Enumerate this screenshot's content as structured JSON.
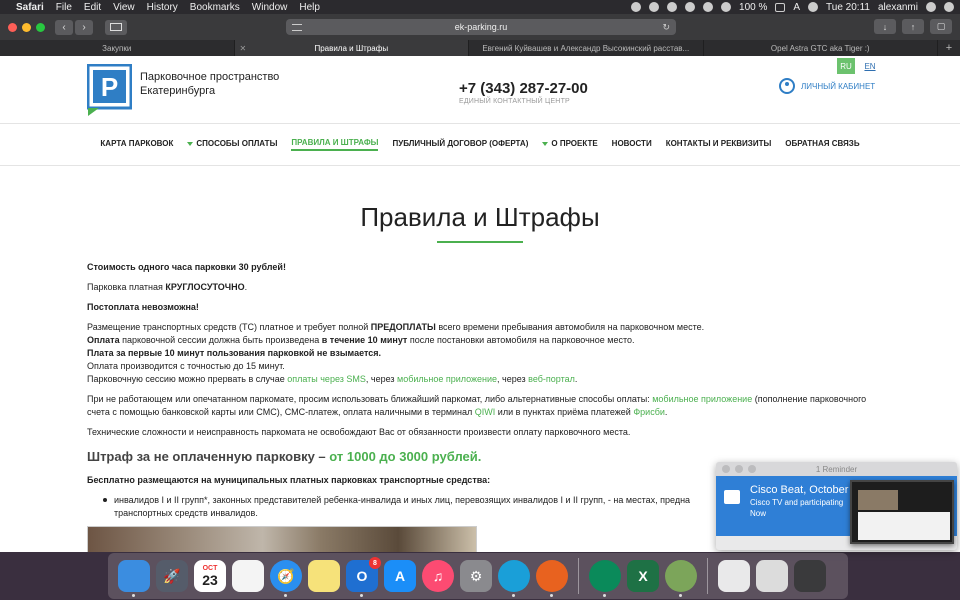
{
  "menubar": {
    "app": "Safari",
    "items": [
      "File",
      "Edit",
      "View",
      "History",
      "Bookmarks",
      "Window",
      "Help"
    ],
    "battery": "100 %",
    "input_lang": "A",
    "clock": "Tue 20:11",
    "user": "alexanmi"
  },
  "browser": {
    "url": "ek-parking.ru",
    "tabs": [
      {
        "label": "Закупки"
      },
      {
        "label": "Правила и Штрафы"
      },
      {
        "label": "Евгений Куйвашев и Александр Высокинский расстав..."
      },
      {
        "label": "Opel Astra GTC aka Tiger :)"
      }
    ]
  },
  "site": {
    "brand_line1": "Парковочное пространство",
    "brand_line2": "Екатеринбурга",
    "phone": "+7 (343) 287-27-00",
    "phone_sub": "ЕДИНЫЙ КОНТАКТНЫЙ ЦЕНТР",
    "lang_ru": "RU",
    "lang_en": "EN",
    "cabinet": "ЛИЧНЫЙ КАБИНЕТ",
    "nav": [
      {
        "label": "КАРТА ПАРКОВОК"
      },
      {
        "label": "СПОСОБЫ ОПЛАТЫ"
      },
      {
        "label": "ПРАВИЛА И ШТРАФЫ"
      },
      {
        "label": "ПУБЛИЧНЫЙ ДОГОВОР (ОФЕРТА)"
      },
      {
        "label": "О ПРОЕКТЕ"
      },
      {
        "label": "НОВОСТИ"
      },
      {
        "label": "КОНТАКТЫ И РЕКВИЗИТЫ"
      },
      {
        "label": "ОБРАТНАЯ СВЯЗЬ"
      }
    ]
  },
  "content": {
    "title": "Правила и Штрафы",
    "p1": "Стоимость одного часа парковки 30 рублей!",
    "p2a": "Парковка платная ",
    "p2b": "КРУГЛОСУТОЧНО",
    "p2c": ".",
    "p3": "Постоплата невозможна!",
    "p4a": "Размещение транспортных средств (ТС) платное и требует полной ",
    "p4b": "ПРЕДОПЛАТЫ",
    "p4c": " всего времени пребывания автомобиля на парковочном месте.",
    "p5a": "Оплата",
    "p5b": " парковочной сессии должна быть произведена ",
    "p5c": "в течение 10 минут",
    "p5d": " после постановки автомобиля на парковочное место.",
    "p6": "Плата за первые 10 минут пользования парковкой не взымается.",
    "p7": "Оплата производится с точностью до 15 минут.",
    "p8a": "Парковочную сессию можно прервать в случае ",
    "p8b": "оплаты через SMS",
    "p8c": ", через ",
    "p8d": "мобильное приложение",
    "p8e": ", через ",
    "p8f": "веб-портал",
    "p8g": ".",
    "p9a": "При не работающем или опечатанном паркомате, просим использовать ближайший паркомат, либо альтернативные способы оплаты: ",
    "p9b": "мобильное приложение",
    "p9c": " (пополнение парковочного счета с помощью банковской карты или СМС), СМС-платеж, оплата наличными в терминал ",
    "p9d": "QIWI",
    "p9e": " или в пунктах приёма платежей ",
    "p9f": "Фрисби",
    "p9g": ".",
    "p10": "Технические сложности и неисправность паркомата не освобождают Вас от обязанности произвести оплату парковочного места.",
    "h2a": "Штраф за не оплаченную парковку – ",
    "h2b": "от 1000 до 3000 рублей.",
    "p11": "Бесплатно размещаются на муниципальных платных парковках транспортные средства:",
    "bullet1": "инвалидов I и II групп*, законных представителей ребенка-инвалида и иных лиц, перевозящих инвалидов I и II групп, - на местах, предна транспортных средств инвалидов."
  },
  "notification": {
    "header": "1 Reminder",
    "title": "Cisco Beat, October",
    "line2": "Cisco TV and participating",
    "line3": "Now"
  },
  "dock": {
    "calendar_month": "OCT",
    "calendar_day": "23",
    "outlook_badge": "8"
  },
  "colors": {
    "accent_green": "#4bb04f",
    "link_blue": "#2f7ec5",
    "notification_blue": "#2f7fd6"
  }
}
